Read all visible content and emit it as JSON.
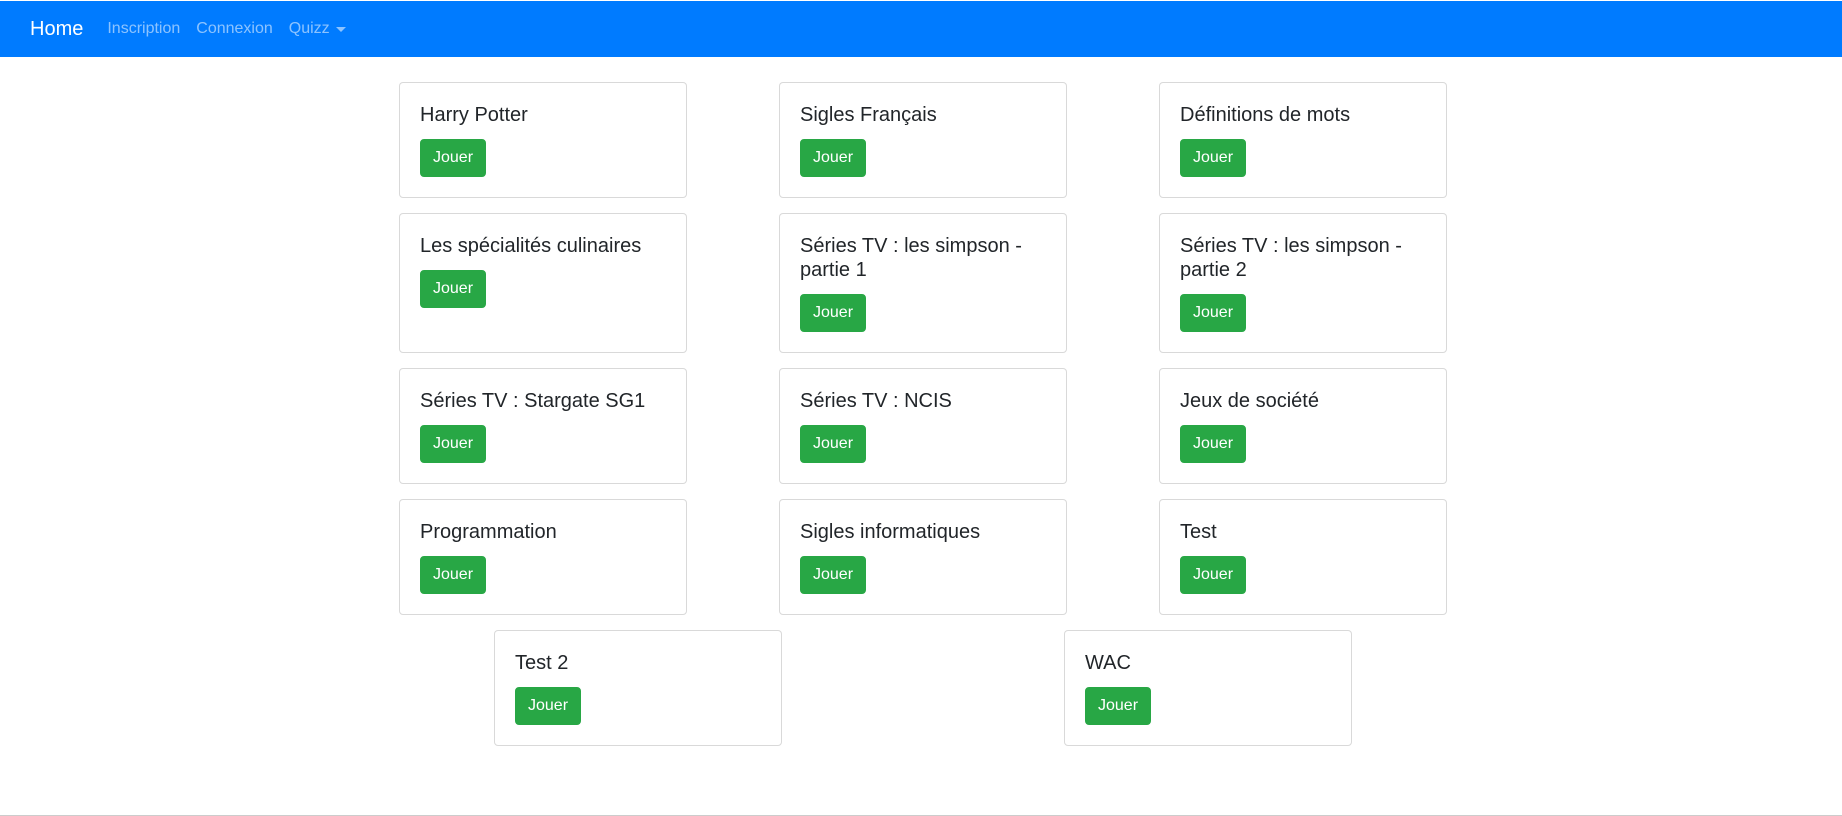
{
  "navbar": {
    "brand": "Home",
    "links": [
      "Inscription",
      "Connexion"
    ],
    "dropdown_label": "Quizz",
    "background": "#007bff"
  },
  "cards": [
    {
      "title": "Harry Potter",
      "button": "Jouer"
    },
    {
      "title": "Sigles Français",
      "button": "Jouer"
    },
    {
      "title": "Définitions de mots",
      "button": "Jouer"
    },
    {
      "title": "Les spécialités culinaires",
      "button": "Jouer"
    },
    {
      "title": "Séries TV : les simpson - partie 1",
      "button": "Jouer"
    },
    {
      "title": "Séries TV : les simpson - partie 2",
      "button": "Jouer"
    },
    {
      "title": "Séries TV : Stargate SG1",
      "button": "Jouer"
    },
    {
      "title": "Séries TV : NCIS",
      "button": "Jouer"
    },
    {
      "title": "Jeux de société",
      "button": "Jouer"
    },
    {
      "title": "Programmation",
      "button": "Jouer"
    },
    {
      "title": "Sigles informatiques",
      "button": "Jouer"
    },
    {
      "title": "Test",
      "button": "Jouer"
    },
    {
      "title": "Test 2",
      "button": "Jouer"
    },
    {
      "title": "WAC",
      "button": "Jouer"
    }
  ],
  "colors": {
    "button": "#28a745",
    "navbar": "#007bff"
  }
}
